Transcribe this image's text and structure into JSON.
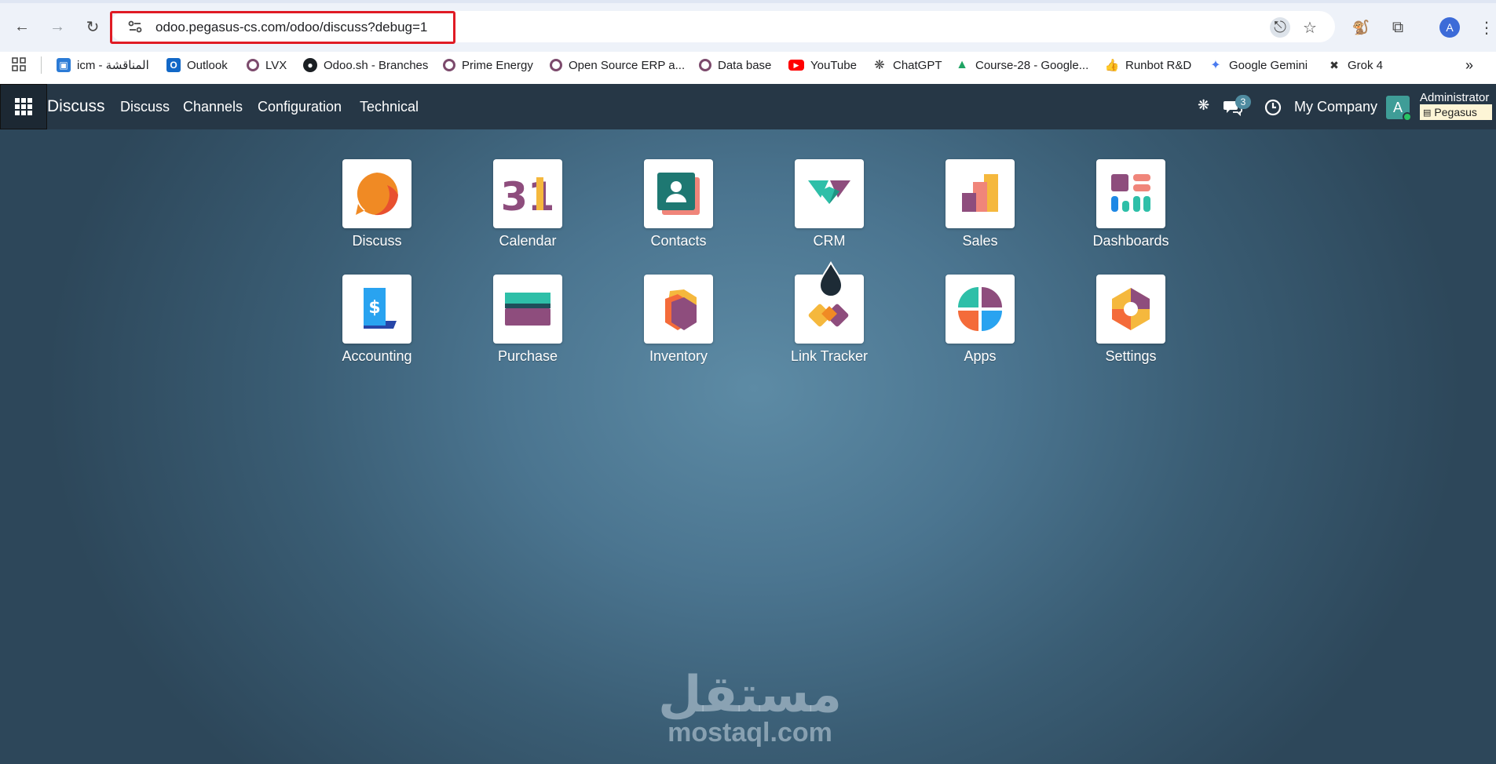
{
  "browser": {
    "url": "odoo.pegasus-cs.com/odoo/discuss?debug=1",
    "profile_initial": "A",
    "bookmarks": [
      {
        "label": "icm - المناقشة",
        "icon": "icm-icon",
        "color": "#2b7bd6"
      },
      {
        "label": "Outlook",
        "icon": "outlook-icon",
        "color": "#1268c7"
      },
      {
        "label": "LVX",
        "icon": "odoo-ring-icon",
        "color": "#7c4a6c"
      },
      {
        "label": "Odoo.sh - Branches",
        "icon": "github-icon",
        "color": "#1b1f23"
      },
      {
        "label": "Prime Energy",
        "icon": "odoo-ring-icon",
        "color": "#7c4a6c"
      },
      {
        "label": "Open Source ERP a...",
        "icon": "odoo-ring-icon",
        "color": "#7c4a6c"
      },
      {
        "label": "Data base",
        "icon": "odoo-ring-icon",
        "color": "#7c4a6c"
      },
      {
        "label": "YouTube",
        "icon": "youtube-icon",
        "color": "#ff0000"
      },
      {
        "label": "ChatGPT",
        "icon": "chatgpt-icon",
        "color": "#444444"
      },
      {
        "label": "Course-28 - Google...",
        "icon": "google-drive-icon",
        "color": "#1fa463"
      },
      {
        "label": "Runbot R&D",
        "icon": "thumbs-up-icon",
        "color": "#2e7d32"
      },
      {
        "label": "Google Gemini",
        "icon": "gemini-icon",
        "color": "#4a7bf0"
      },
      {
        "label": "Grok 4",
        "icon": "grok-icon",
        "color": "#333333"
      }
    ]
  },
  "navbar": {
    "brand": "Discuss",
    "menus": [
      "Discuss",
      "Channels",
      "Configuration",
      "Technical"
    ],
    "message_count": "3",
    "company": "My Company",
    "user_initial": "A",
    "user_name": "Administrator",
    "database": "Pegasus"
  },
  "apps": [
    {
      "label": "Discuss"
    },
    {
      "label": "Calendar",
      "glyph": "31"
    },
    {
      "label": "Contacts"
    },
    {
      "label": "CRM"
    },
    {
      "label": "Sales"
    },
    {
      "label": "Dashboards"
    },
    {
      "label": "Accounting",
      "glyph": "$"
    },
    {
      "label": "Purchase"
    },
    {
      "label": "Inventory"
    },
    {
      "label": "Link Tracker"
    },
    {
      "label": "Apps"
    },
    {
      "label": "Settings"
    }
  ],
  "watermark": {
    "arabic": "مستقل",
    "latin": "mostaql.com"
  },
  "colors": {
    "navbar": "#263746",
    "url_highlight": "#e01b24",
    "db_tag": "#fdf5d6"
  }
}
